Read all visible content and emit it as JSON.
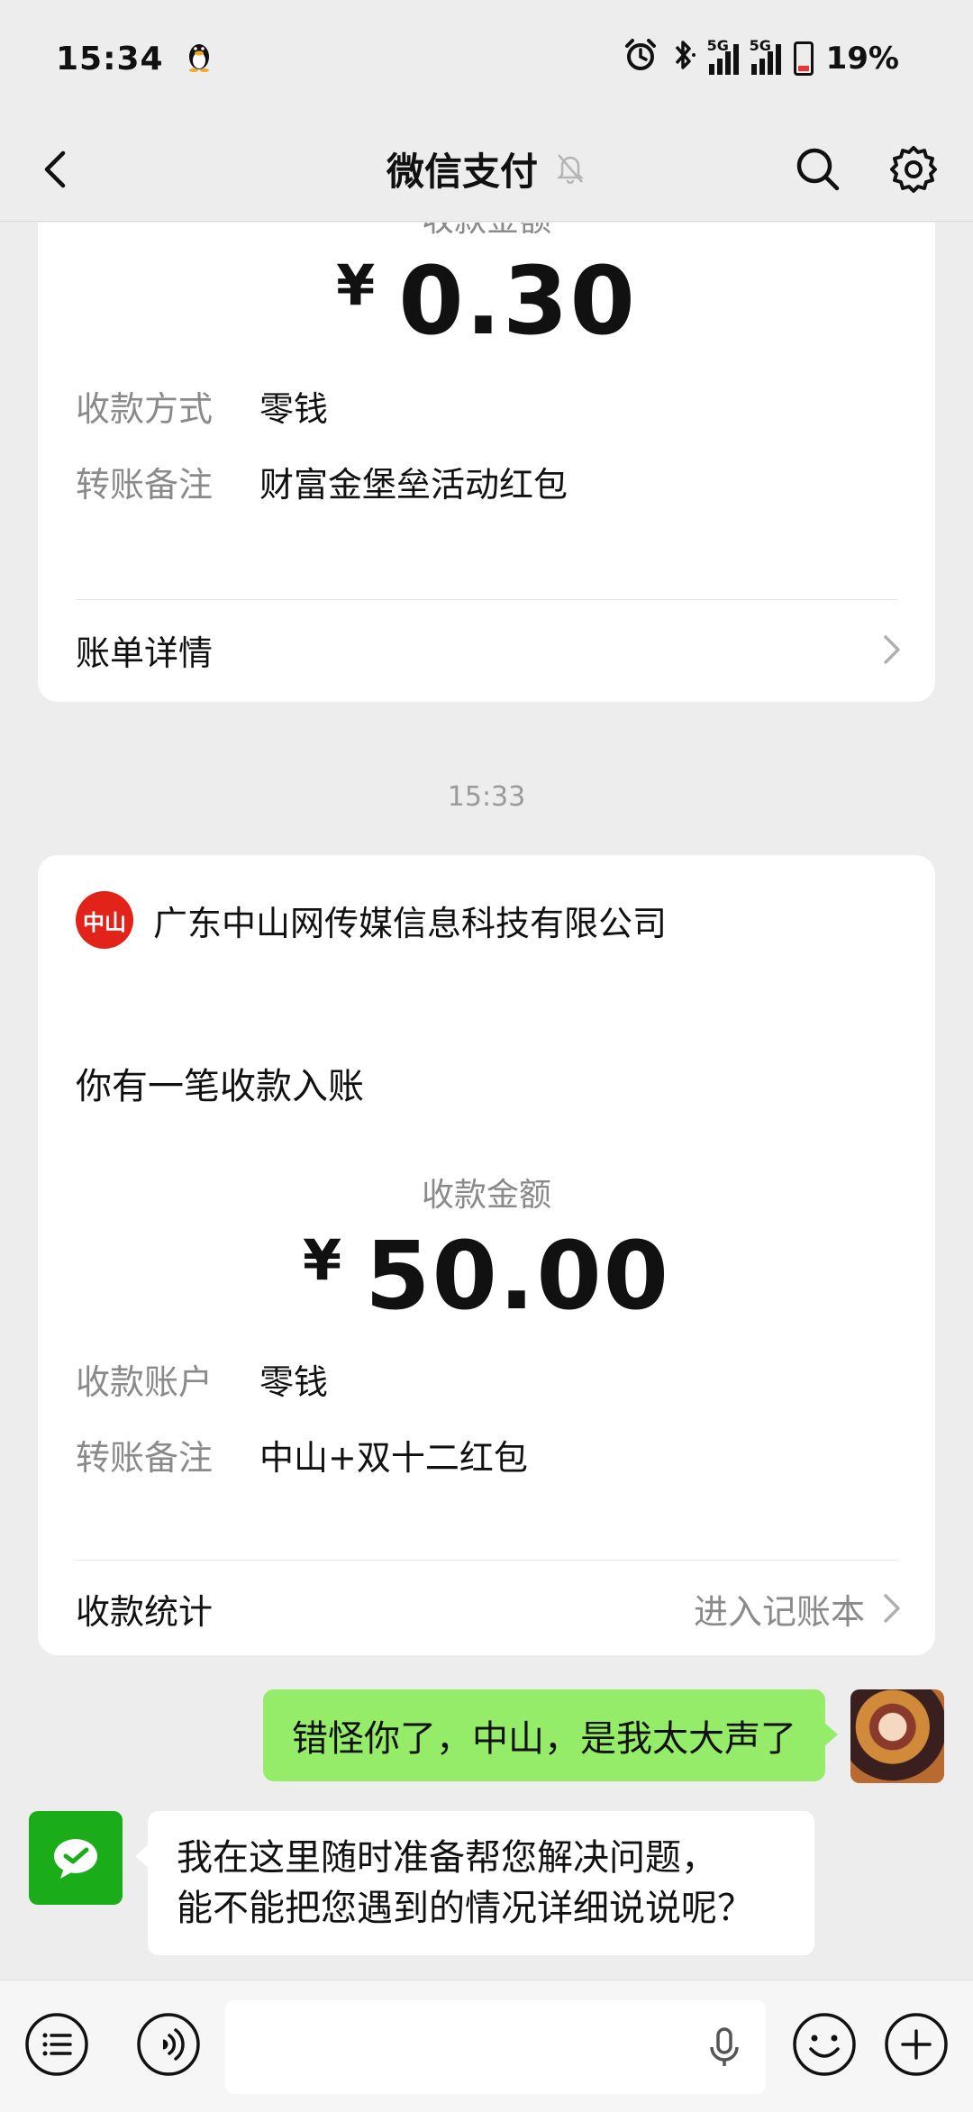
{
  "status_bar": {
    "time": "15:34",
    "network_1": "5G",
    "network_2": "5G",
    "battery_percent": "19%",
    "battery_level": 0.19
  },
  "nav": {
    "title": "微信支付"
  },
  "card1": {
    "amount_label": "收款金额",
    "currency": "¥",
    "amount": "0.30",
    "rows": [
      {
        "key": "收款方式",
        "value": "零钱"
      },
      {
        "key": "转账备注",
        "value": "财富金堡垒活动红包"
      }
    ],
    "link_label": "账单详情"
  },
  "time_separator": "15:33",
  "card2": {
    "merchant_logo_text": "中山",
    "merchant_name": "广东中山网传媒信息科技有限公司",
    "notice": "你有一笔收款入账",
    "amount_label": "收款金额",
    "currency": "¥",
    "amount": "50.00",
    "rows": [
      {
        "key": "收款账户",
        "value": "零钱"
      },
      {
        "key": "转账备注",
        "value": "中山+双十二红包"
      }
    ],
    "link_label": "收款统计",
    "link_right": "进入记账本"
  },
  "chat": {
    "sent_message": "错怪你了，中山，是我太大声了",
    "received_line_1": "我在这里随时准备帮您解决问题，",
    "received_line_2": "能不能把您遇到的情况详细说说呢？"
  },
  "colors": {
    "background": "#ededed",
    "card": "#ffffff",
    "sent_bubble": "#95ec69",
    "wechat_green": "#1aad19",
    "merchant_red": "#e2231a"
  }
}
